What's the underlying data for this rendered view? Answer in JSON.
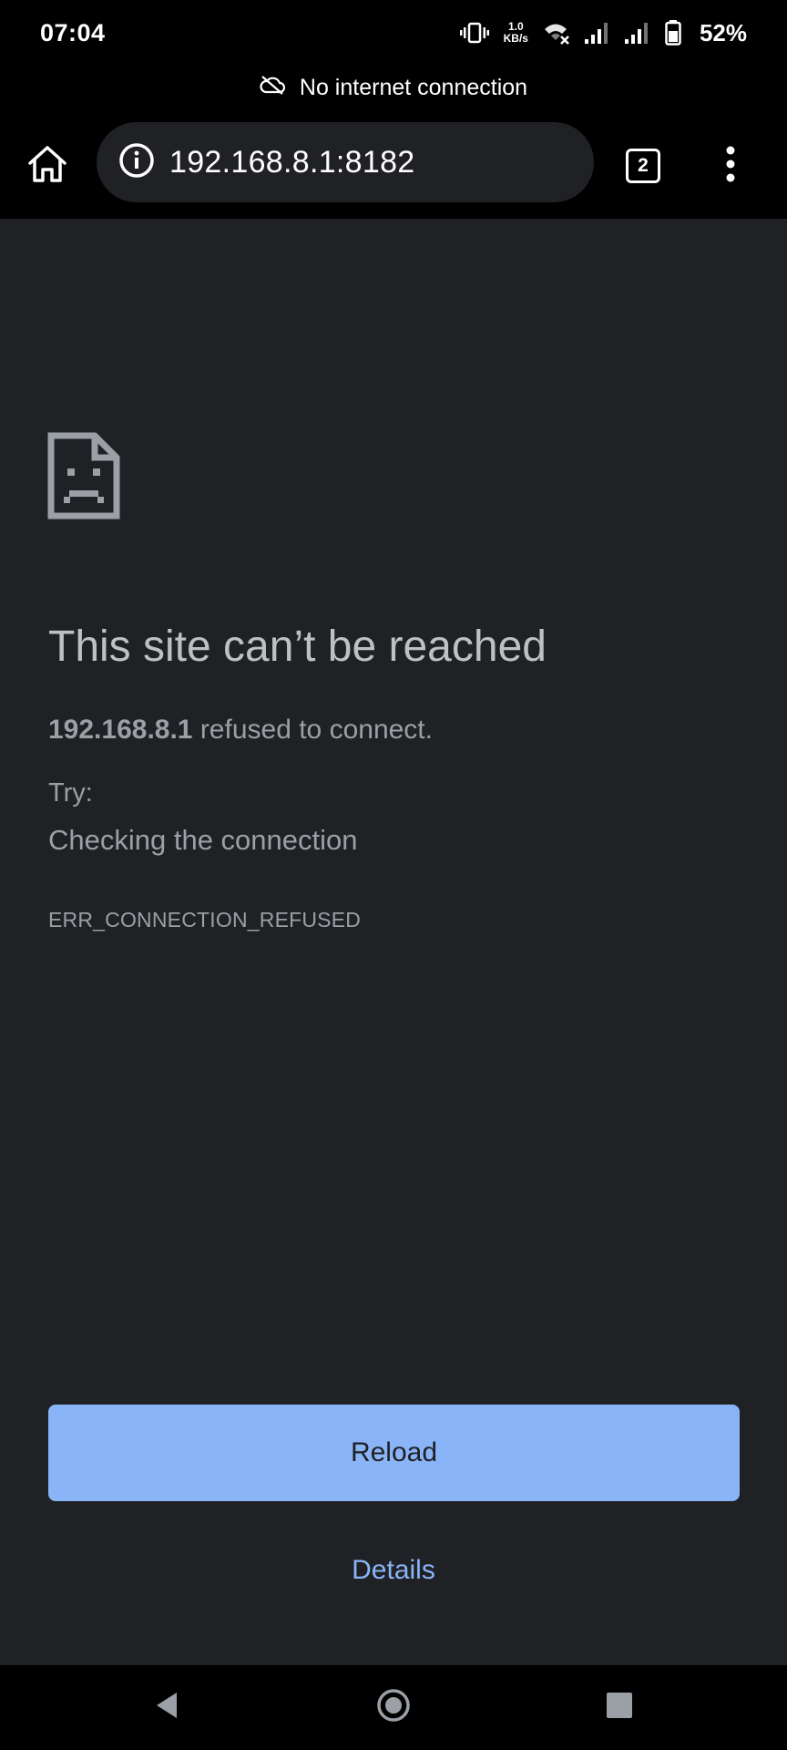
{
  "status_bar": {
    "time": "07:04",
    "net_speed_value": "1.0",
    "net_speed_unit": "KB/s",
    "battery_percent": "52%",
    "icons": [
      "vibrate-icon",
      "wifi-off-icon",
      "signal-icon",
      "signal-icon",
      "battery-icon"
    ]
  },
  "offline_banner": {
    "text": "No internet connection",
    "icon": "cloud-off-icon"
  },
  "toolbar": {
    "url": "192.168.8.1:8182",
    "tab_count": "2",
    "icons": [
      "home-icon",
      "info-icon",
      "more-vert-icon"
    ]
  },
  "error": {
    "title": "This site can’t be reached",
    "host": "192.168.8.1",
    "message_suffix": " refused to connect.",
    "try_label": "Try:",
    "suggestions": [
      "Checking the connection"
    ],
    "code": "ERR_CONNECTION_REFUSED",
    "icon": "sad-page-icon"
  },
  "actions": {
    "reload_label": "Reload",
    "details_label": "Details"
  },
  "colors": {
    "background": "#202124",
    "chrome": "#000000",
    "accent": "#8ab4f8",
    "title_text": "#bdc1c6",
    "body_text": "#9aa0a6"
  }
}
